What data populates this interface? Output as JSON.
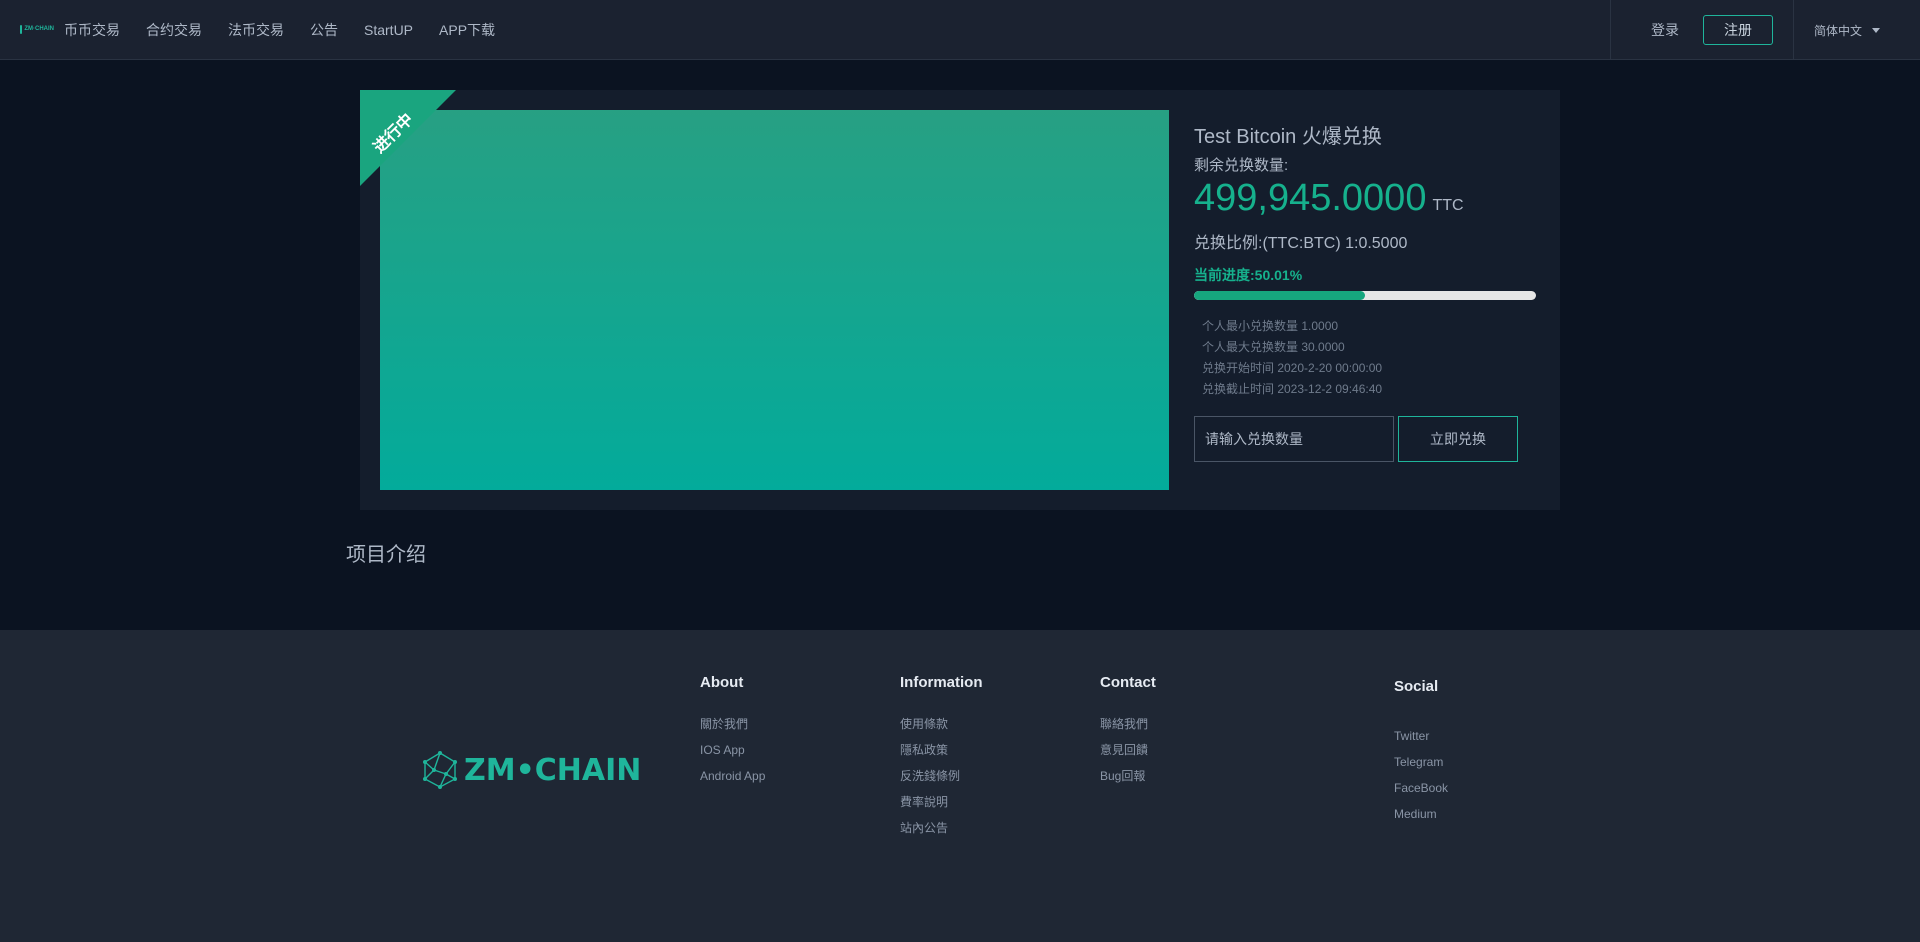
{
  "header": {
    "logo_text": "ZM·CHAIN",
    "nav": [
      "币币交易",
      "合约交易",
      "法币交易",
      "公告",
      "StartUP",
      "APP下载"
    ],
    "login": "登录",
    "register": "注册",
    "language": "简体中文"
  },
  "project": {
    "status_ribbon": "进行中",
    "title": "Test Bitcoin 火爆兑换",
    "remaining_label": "剩余兑换数量:",
    "remaining_amount": "499,945.0000",
    "remaining_unit": "TTC",
    "ratio": "兑换比例:(TTC:BTC) 1:0.5000",
    "progress_label": "当前进度:50.01%",
    "progress_percent": 50.01,
    "details": [
      "个人最小兑换数量 1.0000",
      "个人最大兑换数量 30.0000",
      "兑换开始时间 2020-2-20 00:00:00",
      "兑换截止时间 2023-12-2 09:46:40"
    ],
    "input_placeholder": "请输入兑换数量",
    "submit": "立即兑换"
  },
  "section": {
    "intro_title": "项目介绍"
  },
  "footer": {
    "logo_text": "ZM•CHAIN",
    "about": {
      "title": "About",
      "links": [
        "關於我們",
        "IOS App",
        "Android App"
      ]
    },
    "information": {
      "title": "Information",
      "links": [
        "使用條款",
        "隱私政策",
        "反洗錢條例",
        "費率說明",
        "站內公告"
      ]
    },
    "contact": {
      "title": "Contact",
      "links": [
        "聯絡我們",
        "意見回饋",
        "Bug回報"
      ]
    },
    "social": {
      "title": "Social",
      "links": [
        "Twitter",
        "Telegram",
        "FaceBook",
        "Medium"
      ]
    }
  },
  "colors": {
    "accent": "#1fb59b",
    "background": "#0b1321",
    "header_bg": "#1b2230",
    "footer_bg": "#1f2734",
    "card_bg": "#141d2c"
  }
}
